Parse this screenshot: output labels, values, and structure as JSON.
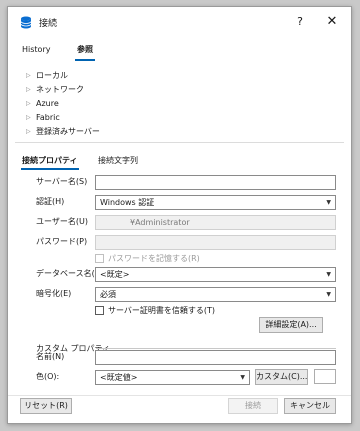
{
  "window": {
    "title": "接続",
    "help_label": "?",
    "close_label": "✕"
  },
  "top_tabs": [
    {
      "label": "History"
    },
    {
      "label": "参照"
    }
  ],
  "tree": [
    {
      "label": "ローカル"
    },
    {
      "label": "ネットワーク"
    },
    {
      "label": "Azure"
    },
    {
      "label": "Fabric"
    },
    {
      "label": "登録済みサーバー"
    }
  ],
  "sub_tabs": [
    {
      "label": "接続プロパティ"
    },
    {
      "label": "接続文字列"
    }
  ],
  "form": {
    "server_name": {
      "label": "サーバー名(S)",
      "value": ""
    },
    "auth": {
      "label": "認証(H)",
      "value": "Windows 認証"
    },
    "username": {
      "label": "ユーザー名(U)",
      "value": "¥Administrator"
    },
    "password": {
      "label": "パスワード(P)",
      "value": ""
    },
    "remember_password": {
      "label": "パスワードを記憶する(R)",
      "checked": false
    },
    "database": {
      "label": "データベース名(D)",
      "value": "<既定>"
    },
    "encrypt": {
      "label": "暗号化(E)",
      "value": "必須"
    },
    "trust_cert": {
      "label": "サーバー証明書を信頼する(T)",
      "checked": false
    },
    "advanced_button": "詳細設定(A)..."
  },
  "custom_props": {
    "section_title": "カスタム プロパティ",
    "name": {
      "label": "名前(N)",
      "value": ""
    },
    "color": {
      "label": "色(O):",
      "value": "<既定値>"
    },
    "custom_button": "カスタム(C)..."
  },
  "footer": {
    "reset_button": "リセット(R)",
    "connect_button": "接続",
    "cancel_button": "キャンセル"
  },
  "colors": {
    "accent": "#0063b1",
    "app_icon": "#0a6ed1"
  },
  "icons": {
    "app": "database-icon",
    "tree_arrow": "chevron-right-icon",
    "dropdown": "chevron-down-icon"
  }
}
